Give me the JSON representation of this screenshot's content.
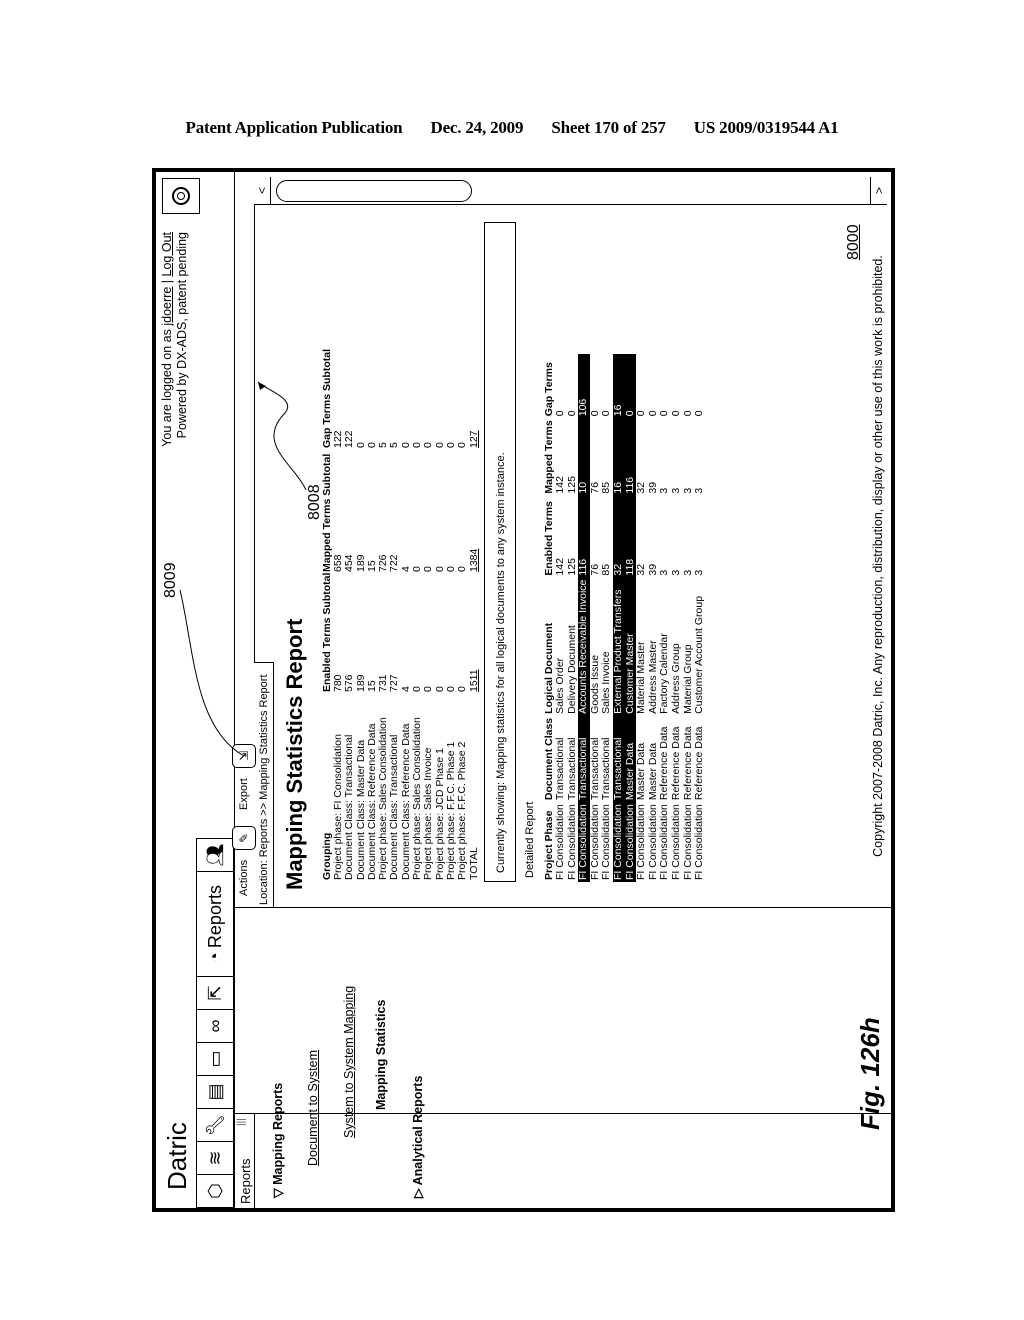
{
  "publication_header": {
    "left": "Patent Application Publication",
    "date": "Dec. 24, 2009",
    "sheet": "Sheet 170 of 257",
    "number": "US 2009/0319544 A1"
  },
  "figure": {
    "label": "Fig. 126h",
    "ref_main": "8000",
    "ref_8009": "8009",
    "ref_8008": "8008"
  },
  "app": {
    "brand": "Datric",
    "user_prefix": "You are logged on as",
    "username": "jdoerre",
    "separator": "|",
    "logout": "Log Out",
    "powered_by": "Powered by DX-ADS, patent pending",
    "toolbar": {
      "icons": [
        "cube-icon",
        "chart-icon",
        "wrench-icon",
        "layout-icon",
        "chip-icon",
        "link-icon",
        "transfer-icon"
      ],
      "reports_label": "Reports",
      "people_icon": "people-icon"
    },
    "power_icon": "power-icon"
  },
  "sidebar": {
    "title": "Reports",
    "grip": "|||",
    "items": [
      {
        "label": "Mapping Reports",
        "icon": "▽",
        "style": "bold"
      },
      {
        "label": "Document to System",
        "style": "link"
      },
      {
        "label": "System to System Mapping",
        "style": "link"
      },
      {
        "label": "Mapping Statistics",
        "style": "bold"
      },
      {
        "label": "Analytical Reports",
        "icon": "▷",
        "style": "bold"
      }
    ]
  },
  "actionbar": {
    "actions_label": "Actions",
    "export_label": "Export"
  },
  "location": "Location: Reports >> Mapping Statistics Report",
  "report": {
    "title": "Mapping Statistics Report",
    "summary": {
      "headers": [
        "Grouping",
        "Enabled Terms Subtotal",
        "Mapped Terms Subtotal",
        "Gap Terms Subtotal"
      ],
      "rows": [
        [
          "Project phase: FI Consolidation",
          "780",
          "658",
          "122"
        ],
        [
          "Document Class: Transactional",
          "576",
          "454",
          "122"
        ],
        [
          "Document Class: Master Data",
          "189",
          "189",
          "0"
        ],
        [
          "Document Class: Reference Data",
          "15",
          "15",
          "0"
        ],
        [
          "Project phase: Sales Consolidation",
          "731",
          "726",
          "5"
        ],
        [
          "Document Class: Transactional",
          "727",
          "722",
          "5"
        ],
        [
          "Document Class: Reference Data",
          "4",
          "4",
          "0"
        ],
        [
          "Project phase: Sales Consolidation",
          "0",
          "0",
          "0"
        ],
        [
          "Project phase: Sales Invoice",
          "0",
          "0",
          "0"
        ],
        [
          "Project phase: JCD Phase 1",
          "0",
          "0",
          "0"
        ],
        [
          "Project phase: F.F.C. Phase 1",
          "0",
          "0",
          "0"
        ],
        [
          "Project phase: F.F.C. Phase 2",
          "0",
          "0",
          "0"
        ]
      ],
      "total": [
        "TOTAL",
        "1511",
        "1384",
        "127"
      ]
    },
    "currently_showing": "Currently showing: Mapping statistics for all logical documents to any system instance.",
    "detail_label": "Detailed Report",
    "detail": {
      "headers": [
        "Project Phase",
        "Document Class",
        "Logical Document",
        "Enabled Terms",
        "Mapped Terms",
        "Gap Terms"
      ],
      "rows": [
        {
          "cells": [
            "FI Consolidation",
            "Transactional",
            "Sales Order",
            "142",
            "142",
            "0"
          ],
          "highlight": false
        },
        {
          "cells": [
            "FI Consolidation",
            "Transactional",
            "Delivery Document",
            "125",
            "125",
            "0"
          ],
          "highlight": false
        },
        {
          "cells": [
            "FI Consolidation",
            "Transactional",
            "Accounts Receivable Invoice",
            "116",
            "10",
            "106"
          ],
          "highlight": true
        },
        {
          "cells": [
            "FI Consolidation",
            "Transactional",
            "Goods Issue",
            "76",
            "76",
            "0"
          ],
          "highlight": false
        },
        {
          "cells": [
            "FI Consolidation",
            "Transactional",
            "Sales Invoice",
            "85",
            "85",
            "0"
          ],
          "highlight": false
        },
        {
          "cells": [
            "FI Consolidation",
            "Transactional",
            "External Product Transfers",
            "32",
            "16",
            "16"
          ],
          "highlight": true
        },
        {
          "cells": [
            "FI Consolidation",
            "Master Data",
            "Customer Master",
            "118",
            "116",
            "0"
          ],
          "highlight": true
        },
        {
          "cells": [
            "FI Consolidation",
            "Master Data",
            "Material Master",
            "32",
            "32",
            "0"
          ],
          "highlight": false
        },
        {
          "cells": [
            "FI Consolidation",
            "Master Data",
            "Address Master",
            "39",
            "39",
            "0"
          ],
          "highlight": false
        },
        {
          "cells": [
            "FI Consolidation",
            "Reference Data",
            "Factory Calendar",
            "3",
            "3",
            "0"
          ],
          "highlight": false
        },
        {
          "cells": [
            "FI Consolidation",
            "Reference Data",
            "Address Group",
            "3",
            "3",
            "0"
          ],
          "highlight": false
        },
        {
          "cells": [
            "FI Consolidation",
            "Reference Data",
            "Material Group",
            "3",
            "3",
            "0"
          ],
          "highlight": false
        },
        {
          "cells": [
            "FI Consolidation",
            "Reference Data",
            "Customer Account Group",
            "3",
            "3",
            "0"
          ],
          "highlight": false
        }
      ]
    }
  },
  "copyright": "Copyright 2007-2008 Datric, Inc.  Any reproduction, distribution, display or other use of this work is prohibited.",
  "scrollbar": {
    "up": "<",
    "down": ">",
    "grip": "|||"
  }
}
